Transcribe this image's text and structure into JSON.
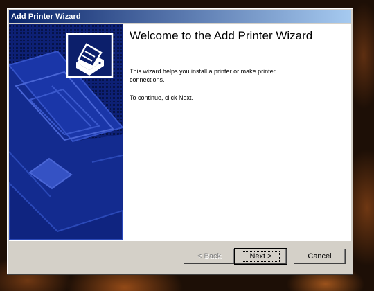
{
  "window": {
    "title": "Add Printer Wizard"
  },
  "banner": {
    "icon": "printer-icon"
  },
  "content": {
    "heading": "Welcome to the Add Printer Wizard",
    "description": "This wizard helps you install a printer or make printer connections.",
    "instruction": "To continue, click Next."
  },
  "buttons": {
    "back_label": "< Back",
    "next_label": "Next >",
    "cancel_label": "Cancel",
    "back_enabled": false
  },
  "colors": {
    "banner_navy": "#0c1f6b",
    "titlebar_start": "#0a246a",
    "titlebar_end": "#a6caf0",
    "dialog_face": "#d4d0c8"
  }
}
